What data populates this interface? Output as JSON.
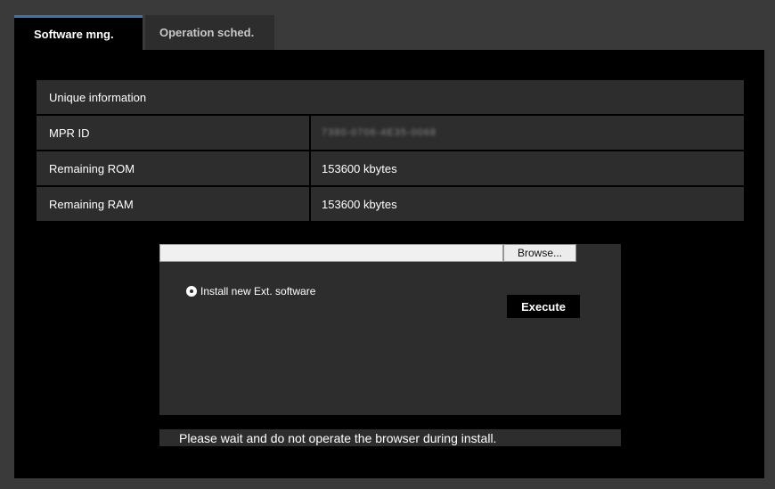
{
  "tabs": [
    {
      "label": "Software mng.",
      "active": true
    },
    {
      "label": "Operation sched.",
      "active": false
    }
  ],
  "info": {
    "header": "Unique information",
    "rows": [
      {
        "label": "MPR ID",
        "value": "7380-0706-4E35-0068",
        "blurred": true
      },
      {
        "label": "Remaining ROM",
        "value": "153600 kbytes"
      },
      {
        "label": "Remaining RAM",
        "value": "153600 kbytes"
      }
    ]
  },
  "uploader": {
    "file_value": "",
    "browse_label": "Browse...",
    "radio_label": "Install new Ext. software",
    "execute_label": "Execute"
  },
  "status": "Please wait and do not operate the browser during install.",
  "colors": {
    "background": "#3a3a3a",
    "panel": "#000000",
    "cell": "#2d2d2d",
    "tab_accent": "#3e73b5"
  }
}
